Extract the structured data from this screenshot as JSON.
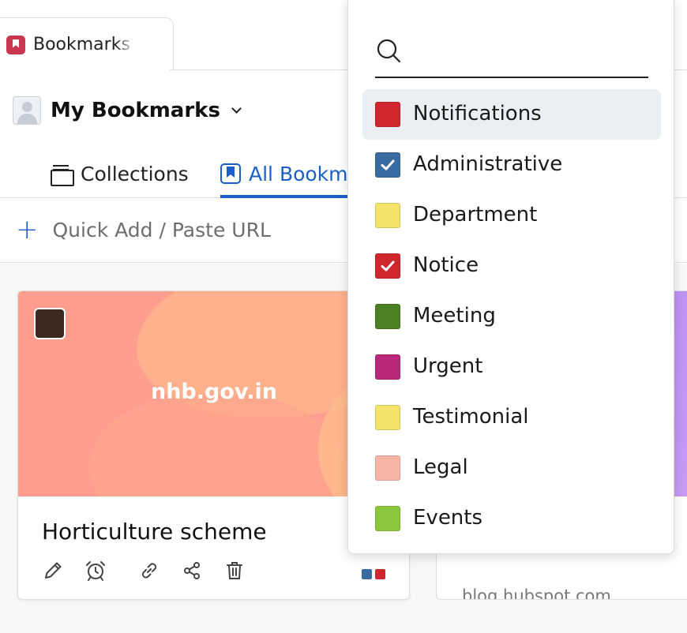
{
  "tab": {
    "label": "Bookmarks",
    "icon": "bookmark-icon",
    "icon_color": "#c9364f"
  },
  "header": {
    "title": "My Bookmarks"
  },
  "subtabs": {
    "collections": "Collections",
    "all": "All Bookmarks",
    "active_color": "#1a5fc8"
  },
  "quick_add": {
    "label": "Quick Add / Paste URL"
  },
  "cards": [
    {
      "domain": "nhb.gov.in",
      "title": "Horticulture scheme",
      "thumb_color": "#3d271e",
      "tag_colors": [
        "#3a6ba0",
        "#d0262e"
      ]
    },
    {
      "domain": "blog.hubspot.com",
      "title": "",
      "url": "blog.hubspot.com"
    }
  ],
  "dropdown": {
    "search_placeholder": "",
    "items": [
      {
        "label": "Notifications",
        "color": "#d0262e",
        "checked": false
      },
      {
        "label": "Administrative",
        "color": "#3a6ba0",
        "checked": true
      },
      {
        "label": "Department",
        "color": "#f3e36a",
        "checked": false
      },
      {
        "label": "Notice",
        "color": "#d0262e",
        "checked": true
      },
      {
        "label": "Meeting",
        "color": "#4c7f21",
        "checked": false
      },
      {
        "label": "Urgent",
        "color": "#b82979",
        "checked": false
      },
      {
        "label": "Testimonial",
        "color": "#f3e36a",
        "checked": false
      },
      {
        "label": "Legal",
        "color": "#f8b6a8",
        "checked": false
      },
      {
        "label": "Events",
        "color": "#8cc63f",
        "checked": false
      }
    ]
  }
}
